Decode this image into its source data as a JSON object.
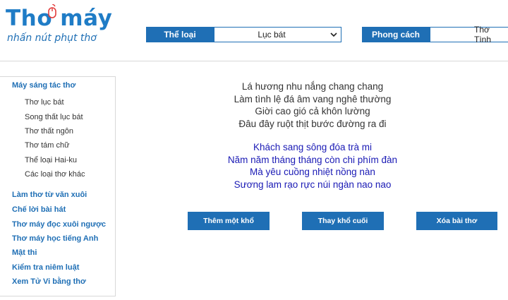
{
  "logo": {
    "title": "Thơ máy",
    "slogan": "nhấn nút phụt thơ"
  },
  "genre_selector": {
    "label": "Thể loại",
    "value": "Lục bát"
  },
  "style_selector": {
    "label": "Phong cách",
    "value": "Thơ Tình"
  },
  "sidebar": {
    "sections": [
      {
        "label": "Máy sáng tác thơ"
      },
      {
        "label": "Làm thơ từ văn xuôi"
      },
      {
        "label": "Chế lời bài hát"
      },
      {
        "label": "Thơ máy đọc xuôi ngược"
      },
      {
        "label": "Thơ máy học tiếng Anh"
      },
      {
        "label": "Mật thi"
      },
      {
        "label": "Kiểm tra niêm luật"
      },
      {
        "label": "Xem Tử Vi bằng thơ"
      }
    ],
    "subitems": [
      {
        "label": "Thơ lục bát"
      },
      {
        "label": "Song thất lục bát"
      },
      {
        "label": "Thơ thất ngôn"
      },
      {
        "label": "Thơ tám chữ"
      },
      {
        "label": "Thể loại Hai-ku"
      },
      {
        "label": "Các loại thơ khác"
      }
    ]
  },
  "poem": {
    "stanza1": [
      "Lá hương nhu nắng chang chang",
      "Làm tình lệ đá âm vang nghê thường",
      "Giời cao gió cả khôn lường",
      "Đâu đây ruột thịt bước đường ra đi"
    ],
    "stanza2": [
      "Khách sang sông đóa trà mi",
      "Năm năm tháng tháng còn chi phím đàn",
      "Mà yêu cuồng nhiệt nồng nàn",
      "Sương lam rạo rực núi ngàn nao nao"
    ]
  },
  "buttons": {
    "add_stanza": "Thêm một khổ",
    "replace_last": "Thay khổ cuối",
    "delete_poem": "Xóa bài thơ"
  },
  "colors": {
    "accent": "#1f6fb5",
    "logo_red": "#e23b3b",
    "stanza2_text": "#1a1ab5"
  }
}
